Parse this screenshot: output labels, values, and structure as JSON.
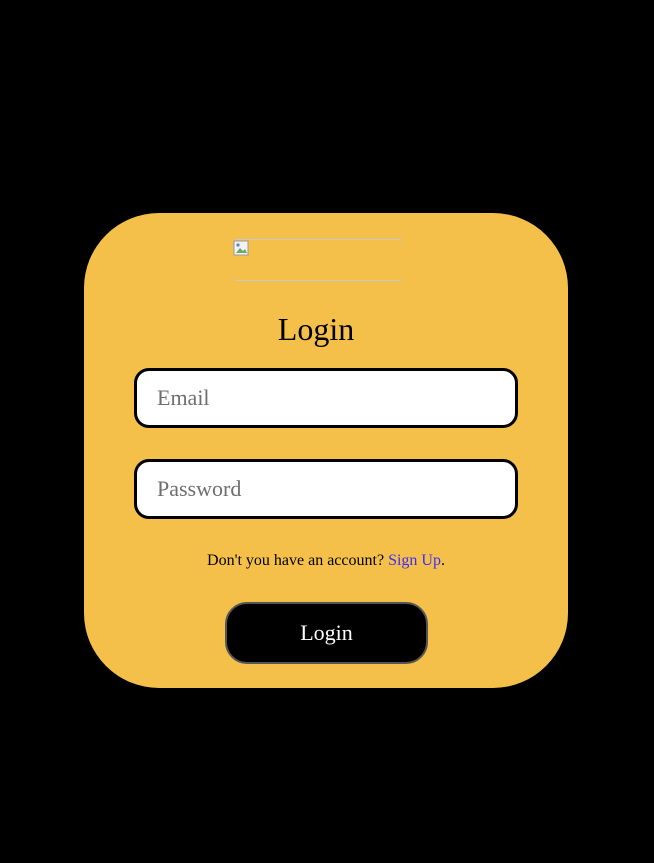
{
  "login_card": {
    "logo_icon": "broken-image-icon",
    "title": "Login",
    "email_placeholder": "Email",
    "password_placeholder": "Password",
    "signup_prompt": "Don't you have an account?",
    "signup_link": "Sign Up",
    "signup_suffix": ".",
    "login_button": "Login"
  },
  "colors": {
    "page_background": "#000000",
    "card_background": "#f5c049",
    "link": "#3b2cff",
    "button_background": "#000000",
    "button_text": "#ffffff"
  }
}
